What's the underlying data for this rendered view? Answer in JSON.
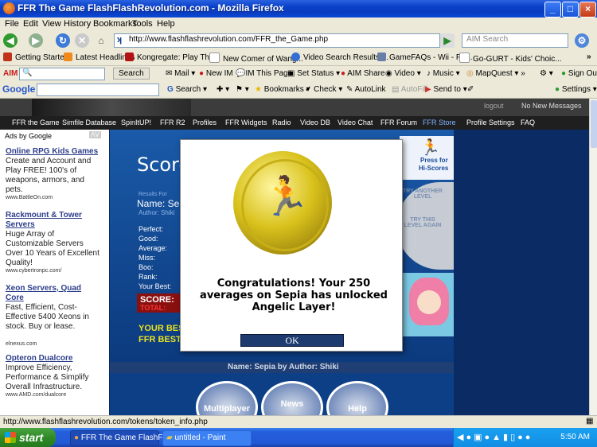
{
  "window": {
    "title": "FFR The Game FlashFlashRevolution.com - Mozilla Firefox",
    "min": "_",
    "max": "□",
    "close": "×"
  },
  "menu": [
    "File",
    "Edit",
    "View",
    "History",
    "Bookmarks",
    "Tools",
    "Help"
  ],
  "nav": {
    "url": "http://www.flashflashrevolution.com/FFR_the_Game.php",
    "search_placeholder": "AIM Search"
  },
  "bookmarks": [
    "Getting Started",
    "Latest Headlines",
    "Kongregate: Play Thi...",
    "New Comer of Wang...",
    "Video Search Results:...",
    "GameFAQs - Wii - FA...",
    "Go-GURT - Kids' Choic..."
  ],
  "aimbar": {
    "search_label": "Search",
    "items": [
      "Mail",
      "New IM",
      "IM This Page",
      "Set Status",
      "AIM Share",
      "Video",
      "Music",
      "MapQuest"
    ],
    "signout": "Sign Out"
  },
  "googlebar": {
    "logo": "Google",
    "items": [
      "Search",
      "Bookmarks",
      "Check",
      "AutoLink",
      "AutoFill",
      "Send to"
    ],
    "settings": "Settings"
  },
  "site": {
    "topright": {
      "logout": "logout",
      "messages": "No New Messages"
    },
    "nav": [
      "FFR the Game",
      "Simfile Database",
      "SpinItUP!",
      "FFR R2",
      "Profiles",
      "FFR Widgets",
      "Radio",
      "Video DB",
      "Video Chat",
      "FFR Forum",
      "FFR Store",
      "Profile Settings",
      "FAQ"
    ],
    "ads_by": "Ads by Google",
    "ads": [
      {
        "title": "Online RPG Kids Games",
        "desc": "Create and Account and Play FREE! 100's of weapons, armors, and pets.",
        "url": "www.BattleOn.com"
      },
      {
        "title": "Rackmount & Tower Servers",
        "desc": "Huge Array of Customizable Servers Over 10 Years of Excellent Quality!",
        "url": "www.cybertronpc.com/"
      },
      {
        "title": "Xeon Servers, Quad Core",
        "desc": "Fast, Efficient, Cost-Effective 5400 Xeons in stock. Buy or lease.",
        "url": "elnexus.com"
      },
      {
        "title": "Opteron Dualcore",
        "desc": "Improve Efficiency, Performance & Simplify Overall Infrastructure.",
        "url": "www.AMD.com/dualcore"
      }
    ],
    "game": {
      "score_title": "Score",
      "results_for": "Results For",
      "name_line": "Name: Sepia",
      "author_line": "Author: Shiki",
      "stats": [
        "Perfect:",
        "Good:",
        "Average:",
        "Miss:",
        "Boo:",
        "Rank:",
        "Your Best:"
      ],
      "score_label": "SCORE:",
      "total_label": "TOTAL:",
      "your_best": "YOUR BEST:",
      "ffr_best": "FFR BEST:",
      "press_for": "Press for",
      "hi_scores": "Hi-Scores",
      "try_another": "TRY ANOTHER LEVEL",
      "try_this": "TRY THIS LEVEL AGAIN",
      "footer_name": "Name: Sepia by Author: Shiki",
      "buttons": [
        "Multiplayer",
        "News",
        "Help"
      ]
    },
    "dialog": {
      "message": "Congratulations!  Your 250 averages on Sepia has unlocked Angelic Layer!",
      "ok": "OK"
    }
  },
  "status": "http://www.flashflashrevolution.com/tokens/token_info.php",
  "taskbar": {
    "start": "start",
    "tasks": [
      "FFR The Game FlashF...",
      "untitled - Paint"
    ],
    "time": "5:50 AM"
  }
}
